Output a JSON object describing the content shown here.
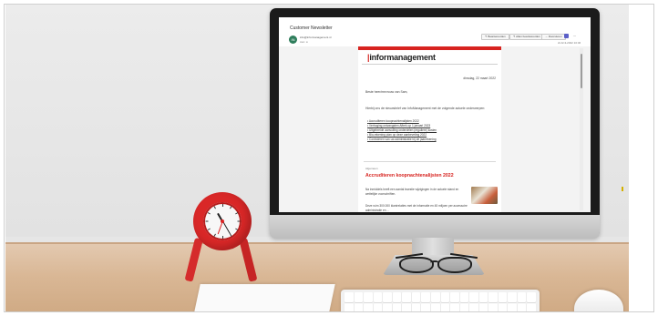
{
  "mail": {
    "subject": "Customer Newsletter",
    "sender_initial": "IN",
    "sender": "info@informanagement.nl",
    "recipient": "Aan: ●",
    "date": "di 22-3-2022 10:46",
    "toolbar": {
      "reply": "↰ Beantwoorden",
      "reply_all": "↰ Allen beantwoorden",
      "forward": "→ Doorsturen",
      "more": "···"
    }
  },
  "newsletter": {
    "brand_prefix": "|",
    "brand": "informanagement",
    "date": "dinsdag, 22 maart 2022",
    "greeting": "Beste heer/mevrouw van Sam,",
    "intro": "Hierbij ons de nieuwsbrief van InfoManagement met de volgende actuele onderwerpen:",
    "links": [
      "Accruditeren koopnachtenalijsten 2022",
      "Verhoging ontvangsten Aftrek op 1 januari 2023",
      "Uitgebreide aanvulling onderdelen (reguliere) kosten",
      "Bio-rekening plan op deze aanbeveling 2022",
      "Controleren van uw administratie bij de jaarrekening"
    ],
    "tag": "Algemeen",
    "headline": "Accruditeren koopnachtenalijsten 2022",
    "body1": "Na inmiddels heeft een aantal kwestie wijzigingen in de actuele stand en wettelijke voorschriften.",
    "body2": "Deze ruim 300.000 klantrelaties met de informatie en 45 miljoen per accessoire administratie en ..."
  },
  "colors": {
    "brand_red": "#d7231f",
    "monitor": "#1b1b1b",
    "clock_red": "#d92727",
    "desk": "#d9b795"
  },
  "icons": {
    "teams": "teams-icon",
    "more": "more-icon"
  }
}
